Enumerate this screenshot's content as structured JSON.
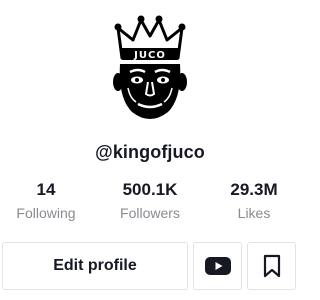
{
  "profile": {
    "username": "@kingofjuco",
    "avatar_crown_text": "JUCO",
    "avatar_icon": "crowned-face-logo-icon"
  },
  "stats": [
    {
      "value": "14",
      "label": "Following"
    },
    {
      "value": "500.1K",
      "label": "Followers"
    },
    {
      "value": "29.3M",
      "label": "Likes"
    }
  ],
  "actions": {
    "edit_label": "Edit profile",
    "youtube_icon": "youtube-icon",
    "bookmark_icon": "bookmark-icon"
  },
  "colors": {
    "text_primary": "#161823",
    "text_secondary": "#8a8b91",
    "border": "#e3e3e4"
  }
}
